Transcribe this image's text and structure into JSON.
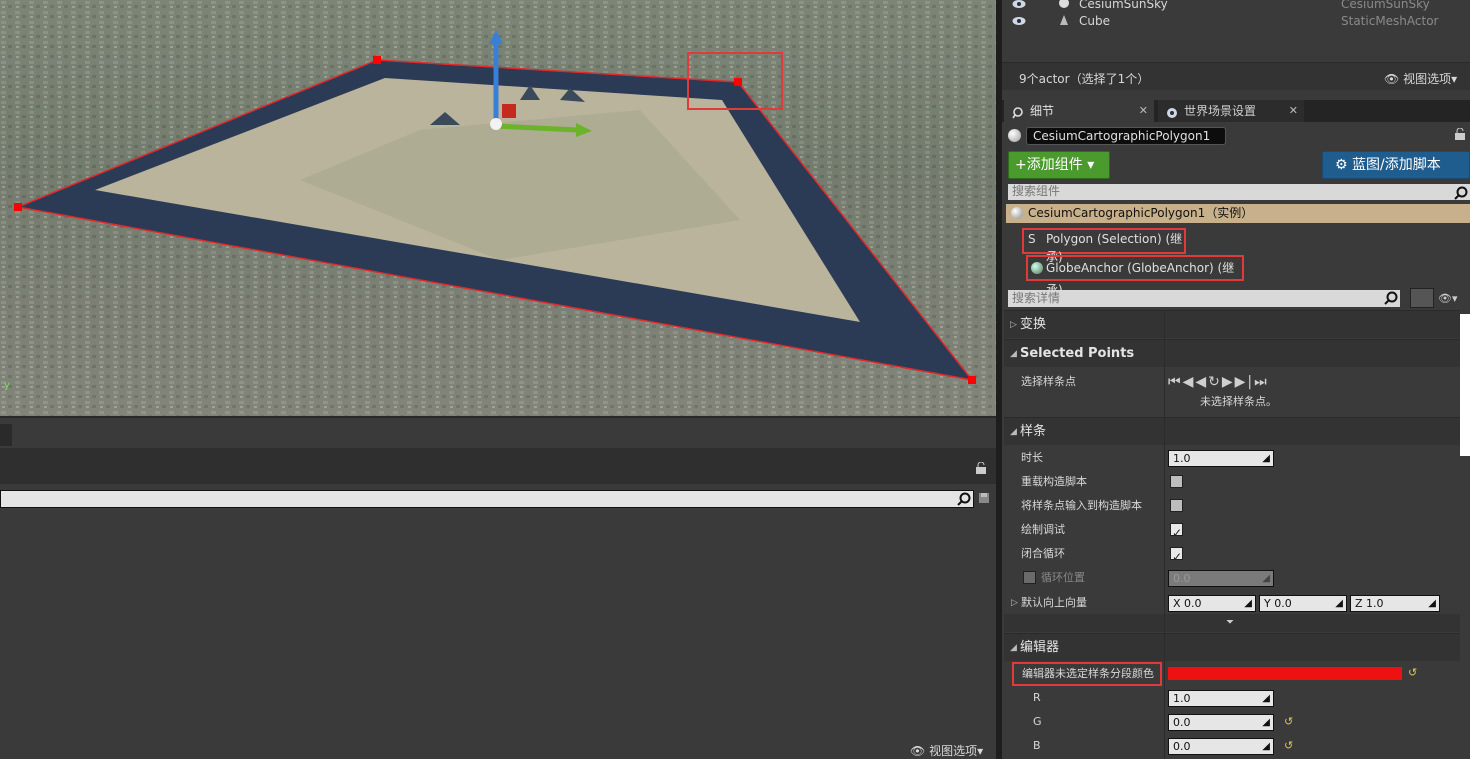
{
  "outliner": {
    "rows": [
      {
        "name": "CesiumSunSky",
        "type": "CesiumSunSky"
      },
      {
        "name": "Cube",
        "type": "StaticMeshActor"
      }
    ],
    "actor_count": "9个actor（选择了1个）",
    "view_options": "视图选项"
  },
  "tabs": [
    {
      "label": "细节"
    },
    {
      "label": "世界场景设置"
    }
  ],
  "actor_name": "CesiumCartographicPolygon1",
  "buttons": {
    "add_component": "添加组件",
    "blueprint": "蓝图/添加脚本"
  },
  "component_search_placeholder": "搜索组件",
  "components": {
    "root": "CesiumCartographicPolygon1（实例）",
    "polygon": "Polygon (Selection) (继承)",
    "anchor": "GlobeAnchor (GlobeAnchor) (继承)"
  },
  "details_search_placeholder": "搜索详情",
  "categories": {
    "transform": "变换",
    "selected_points": "Selected Points",
    "spline": "样条",
    "editor": "编辑器"
  },
  "selected_points": {
    "label": "选择样条点",
    "status": "未选择样条点。"
  },
  "spline": {
    "duration_label": "时长",
    "duration_value": "1.0",
    "override_construction": "重载构造脚本",
    "input_to_construction": "将样条点输入到构造脚本",
    "draw_debug": "绘制调试",
    "closed_loop": "闭合循环",
    "loop_position": "循环位置",
    "loop_position_value": "0.0",
    "default_up": "默认向上向量",
    "up_x": "X  0.0",
    "up_y": "Y  0.0",
    "up_z": "Z  1.0",
    "draw_debug_checked": true,
    "closed_loop_checked": true
  },
  "editor": {
    "unselected_color_label": "编辑器未选定样条分段颜色",
    "color": "#ee1111",
    "r_label": "R",
    "r_value": "1.0",
    "g_label": "G",
    "g_value": "0.0",
    "b_label": "B",
    "b_value": "0.0"
  },
  "viewport": {
    "axis_label": "y"
  },
  "lower_view_options": "视图选项"
}
